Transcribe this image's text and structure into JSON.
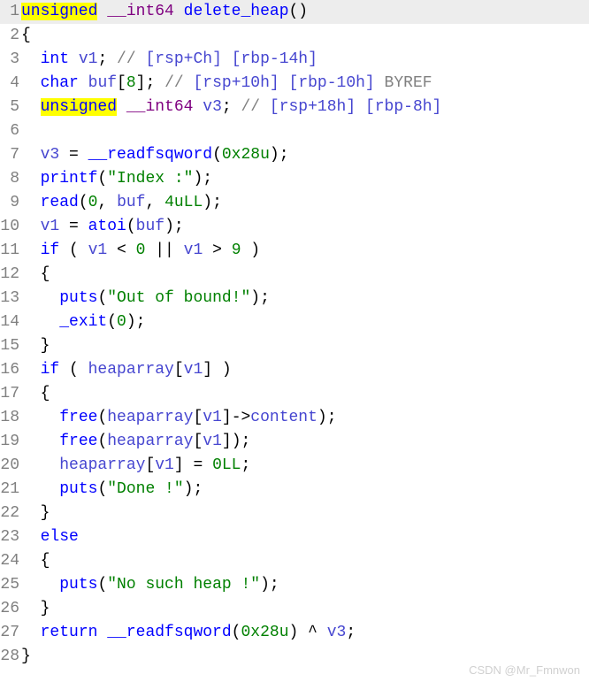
{
  "watermark": "CSDN @Mr_Fmnwon",
  "gutter": {
    "l1": "1",
    "l2": "2",
    "l3": "3",
    "l4": "4",
    "l5": "5",
    "l6": "6",
    "l7": "7",
    "l8": "8",
    "l9": "9",
    "l10": "10",
    "l11": "11",
    "l12": "12",
    "l13": "13",
    "l14": "14",
    "l15": "15",
    "l16": "16",
    "l17": "17",
    "l18": "18",
    "l19": "19",
    "l20": "20",
    "l21": "21",
    "l22": "22",
    "l23": "23",
    "l24": "24",
    "l25": "25",
    "l26": "26",
    "l27": "27",
    "l28": "28"
  },
  "line1": {
    "unsigned": "unsigned",
    "sp1": " ",
    "int64": "__int64",
    "sp2": " ",
    "fname": "delete_heap",
    "paren": "()"
  },
  "line2": {
    "brace": "{"
  },
  "line3": {
    "indent": "  ",
    "int": "int",
    "sp": " ",
    "v1": "v1",
    "semi": "; ",
    "c1": "// ",
    "rsp": "[rsp+Ch]",
    "sp2": " ",
    "rbp": "[rbp-14h]"
  },
  "line4": {
    "indent": "  ",
    "char": "char",
    "sp": " ",
    "buf": "buf",
    "arr": "[",
    "n": "8",
    "arr2": "]; ",
    "c1": "// ",
    "rsp": "[rsp+10h]",
    "sp2": " ",
    "rbp": "[rbp-10h]",
    "sp3": " ",
    "byref": "BYREF"
  },
  "line5": {
    "indent": "  ",
    "unsigned": "unsigned",
    "sp": " ",
    "int64": "__int64",
    "sp2": " ",
    "v3": "v3",
    "semi": "; ",
    "c1": "// ",
    "rsp": "[rsp+18h]",
    "sp3": " ",
    "rbp": "[rbp-8h]"
  },
  "line7": {
    "indent": "  ",
    "v3": "v3",
    "eq": " = ",
    "fn": "__readfsqword",
    "op": "(",
    "hex": "0x28u",
    "cp": ");"
  },
  "line8": {
    "indent": "  ",
    "fn": "printf",
    "op": "(",
    "s": "\"Index :\"",
    "cp": ");"
  },
  "line9": {
    "indent": "  ",
    "fn": "read",
    "op": "(",
    "z": "0",
    "c": ", ",
    "buf": "buf",
    "c2": ", ",
    "n": "4uLL",
    "cp": ");"
  },
  "line10": {
    "indent": "  ",
    "v1": "v1",
    "eq": " = ",
    "fn": "atoi",
    "op": "(",
    "buf": "buf",
    "cp": ");"
  },
  "line11": {
    "indent": "  ",
    "if": "if",
    "sp": " ( ",
    "v1": "v1",
    "lt": " < ",
    "z": "0",
    "or": " || ",
    "v1b": "v1",
    "gt": " > ",
    "n": "9",
    "cp": " )"
  },
  "line12": {
    "indent": "  ",
    "brace": "{"
  },
  "line13": {
    "indent": "    ",
    "fn": "puts",
    "op": "(",
    "s": "\"Out of bound!\"",
    "cp": ");"
  },
  "line14": {
    "indent": "    ",
    "fn": "_exit",
    "op": "(",
    "z": "0",
    "cp": ");"
  },
  "line15": {
    "indent": "  ",
    "brace": "}"
  },
  "line16": {
    "indent": "  ",
    "if": "if",
    "sp": " ( ",
    "arr": "heaparray",
    "ob": "[",
    "v1": "v1",
    "cb": "] )"
  },
  "line17": {
    "indent": "  ",
    "brace": "{"
  },
  "line18": {
    "indent": "    ",
    "fn": "free",
    "op": "(",
    "arr": "heaparray",
    "ob": "[",
    "v1": "v1",
    "cb": "]->",
    "member": "content",
    "cp": ");"
  },
  "line19": {
    "indent": "    ",
    "fn": "free",
    "op": "(",
    "arr": "heaparray",
    "ob": "[",
    "v1": "v1",
    "cb": "]);"
  },
  "line20": {
    "indent": "    ",
    "arr": "heaparray",
    "ob": "[",
    "v1": "v1",
    "cb": "] = ",
    "z": "0LL",
    "semi": ";"
  },
  "line21": {
    "indent": "    ",
    "fn": "puts",
    "op": "(",
    "s": "\"Done !\"",
    "cp": ");"
  },
  "line22": {
    "indent": "  ",
    "brace": "}"
  },
  "line23": {
    "indent": "  ",
    "else": "else"
  },
  "line24": {
    "indent": "  ",
    "brace": "{"
  },
  "line25": {
    "indent": "    ",
    "fn": "puts",
    "op": "(",
    "s": "\"No such heap !\"",
    "cp": ");"
  },
  "line26": {
    "indent": "  ",
    "brace": "}"
  },
  "line27": {
    "indent": "  ",
    "ret": "return",
    "sp": " ",
    "fn": "__readfsqword",
    "op": "(",
    "hex": "0x28u",
    "cp": ") ^ ",
    "v3": "v3",
    "semi": ";"
  },
  "line28": {
    "brace": "}"
  }
}
